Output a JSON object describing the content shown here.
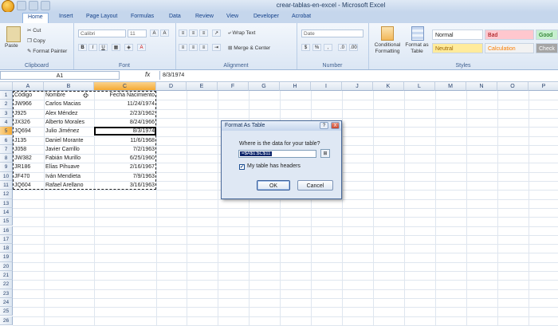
{
  "window": {
    "title": "crear-tablas-en-excel - Microsoft Excel"
  },
  "tabs": [
    "Home",
    "Insert",
    "Page Layout",
    "Formulas",
    "Data",
    "Review",
    "View",
    "Developer",
    "Acrobat"
  ],
  "ribbon": {
    "clipboard": {
      "paste": "Paste",
      "cut": "Cut",
      "copy": "Copy",
      "format_painter": "Format Painter",
      "label": "Clipboard"
    },
    "font": {
      "name": "Calibri",
      "size": "11",
      "label": "Font",
      "bold": "B",
      "italic": "I",
      "underline": "U"
    },
    "alignment": {
      "wrap": "Wrap Text",
      "merge": "Merge & Center",
      "label": "Alignment"
    },
    "number": {
      "format": "Date",
      "label": "Number",
      "currency": "$",
      "percent": "%",
      "comma": ","
    },
    "styles": {
      "conditional": "Conditional Formatting",
      "format_table": "Format as Table",
      "label": "Styles",
      "cells": [
        {
          "name": "Normal",
          "bg": "#ffffff",
          "color": "#222222"
        },
        {
          "name": "Bad",
          "bg": "#ffc7ce",
          "color": "#9c0006"
        },
        {
          "name": "Good",
          "bg": "#c6efce",
          "color": "#006100"
        },
        {
          "name": "Neutral",
          "bg": "#ffeb9c",
          "color": "#9c6500"
        },
        {
          "name": "Calculation",
          "bg": "#f2f2f2",
          "color": "#fa7d00"
        },
        {
          "name": "Check",
          "bg": "#a5a5a5",
          "color": "#ffffff"
        }
      ]
    }
  },
  "formula_bar": {
    "name_box": "A1",
    "fx": "fx",
    "value": "8/3/1974"
  },
  "columns": [
    "A",
    "B",
    "C",
    "D",
    "E",
    "F",
    "G",
    "H",
    "I",
    "J",
    "K",
    "L",
    "M",
    "N",
    "O",
    "P"
  ],
  "rows": [
    "1",
    "2",
    "3",
    "4",
    "5",
    "6",
    "7",
    "8",
    "9",
    "10",
    "11",
    "12",
    "13",
    "14",
    "15",
    "16",
    "17",
    "18",
    "19",
    "20",
    "21",
    "22",
    "23",
    "24",
    "25",
    "26"
  ],
  "table": [
    [
      "Código",
      "Nombre",
      "Fecha Nacimiento"
    ],
    [
      "JW966",
      "Carlos Macias",
      "11/24/1974"
    ],
    [
      "J925",
      "Alex Méndez",
      "2/23/1962"
    ],
    [
      "JX326",
      "Alberto Morales",
      "8/24/1966"
    ],
    [
      "JQ694",
      "Julio Jiménez",
      "8/3/1974"
    ],
    [
      "J135",
      "Daniel Morante",
      "11/6/1968"
    ],
    [
      "J058",
      "Javier Carrillo",
      "7/2/1963"
    ],
    [
      "JW382",
      "Fabián Murillo",
      "6/25/1960"
    ],
    [
      "JR186",
      "Elías Pihuave",
      "2/16/1967"
    ],
    [
      "JF470",
      "Iván Mendieta",
      "7/9/1963"
    ],
    [
      "JQ604",
      "Rafael Arellano",
      "3/16/1963"
    ]
  ],
  "dialog": {
    "title": "Format As Table",
    "question_btn": "?",
    "close_btn": "X",
    "prompt": "Where is the data for your table?",
    "range": "=$A$1:$C$11",
    "has_headers": "My table has headers",
    "ok": "OK",
    "cancel": "Cancel"
  }
}
